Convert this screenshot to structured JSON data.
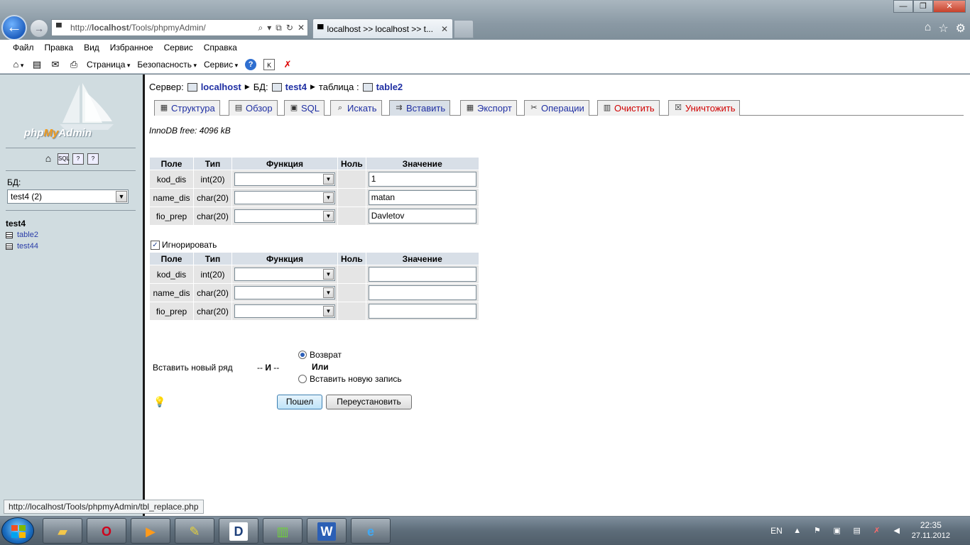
{
  "browser": {
    "address_prefix": "http://",
    "address_host": "localhost",
    "address_path": "/Tools/phpmyAdmin/",
    "tab_title": "localhost >> localhost >> t...",
    "menu": [
      "Файл",
      "Правка",
      "Вид",
      "Избранное",
      "Сервис",
      "Справка"
    ],
    "commands": {
      "page": "Страница",
      "safety": "Безопасность",
      "tools": "Сервис"
    },
    "status_url": "http://localhost/Tools/phpmyAdmin/tbl_replace.php"
  },
  "left": {
    "logo_prefix": "php",
    "logo_my": "My",
    "logo_suffix": "Admin",
    "db_label": "БД:",
    "db_selected": "test4 (2)",
    "db_name": "test4",
    "tables": [
      "table2",
      "test44"
    ]
  },
  "crumbs": {
    "server_label": "Сервер:",
    "server": "localhost",
    "db_label": "БД:",
    "db": "test4",
    "table_label": "таблица :",
    "table": "table2"
  },
  "tabs": [
    {
      "label": "Структура"
    },
    {
      "label": "Обзор"
    },
    {
      "label": "SQL"
    },
    {
      "label": "Искать"
    },
    {
      "label": "Вставить"
    },
    {
      "label": "Экспорт"
    },
    {
      "label": "Операции"
    },
    {
      "label": "Очистить"
    },
    {
      "label": "Уничтожить"
    }
  ],
  "innodb": "InnoDB free: 4096 kB",
  "headers": [
    "Поле",
    "Тип",
    "Функция",
    "Ноль",
    "Значение"
  ],
  "form1": [
    {
      "field": "kod_dis",
      "type": "int(20)",
      "value": "1"
    },
    {
      "field": "name_dis",
      "type": "char(20)",
      "value": "matan"
    },
    {
      "field": "fio_prep",
      "type": "char(20)",
      "value": "Davletov"
    }
  ],
  "ignore_label": "Игнорировать",
  "form2": [
    {
      "field": "kod_dis",
      "type": "int(20)",
      "value": ""
    },
    {
      "field": "name_dis",
      "type": "char(20)",
      "value": ""
    },
    {
      "field": "fio_prep",
      "type": "char(20)",
      "value": ""
    }
  ],
  "after": {
    "insert_row": "Вставить новый ряд",
    "and_prefix": "-- ",
    "and": "И",
    "and_suffix": " --",
    "opt_return": "Возврат",
    "or": "Или",
    "opt_new": "Вставить новую запись"
  },
  "buttons": {
    "go": "Пошел",
    "reset": "Переустановить"
  },
  "tray": {
    "lang": "EN",
    "time": "22:35",
    "date": "27.11.2012"
  }
}
